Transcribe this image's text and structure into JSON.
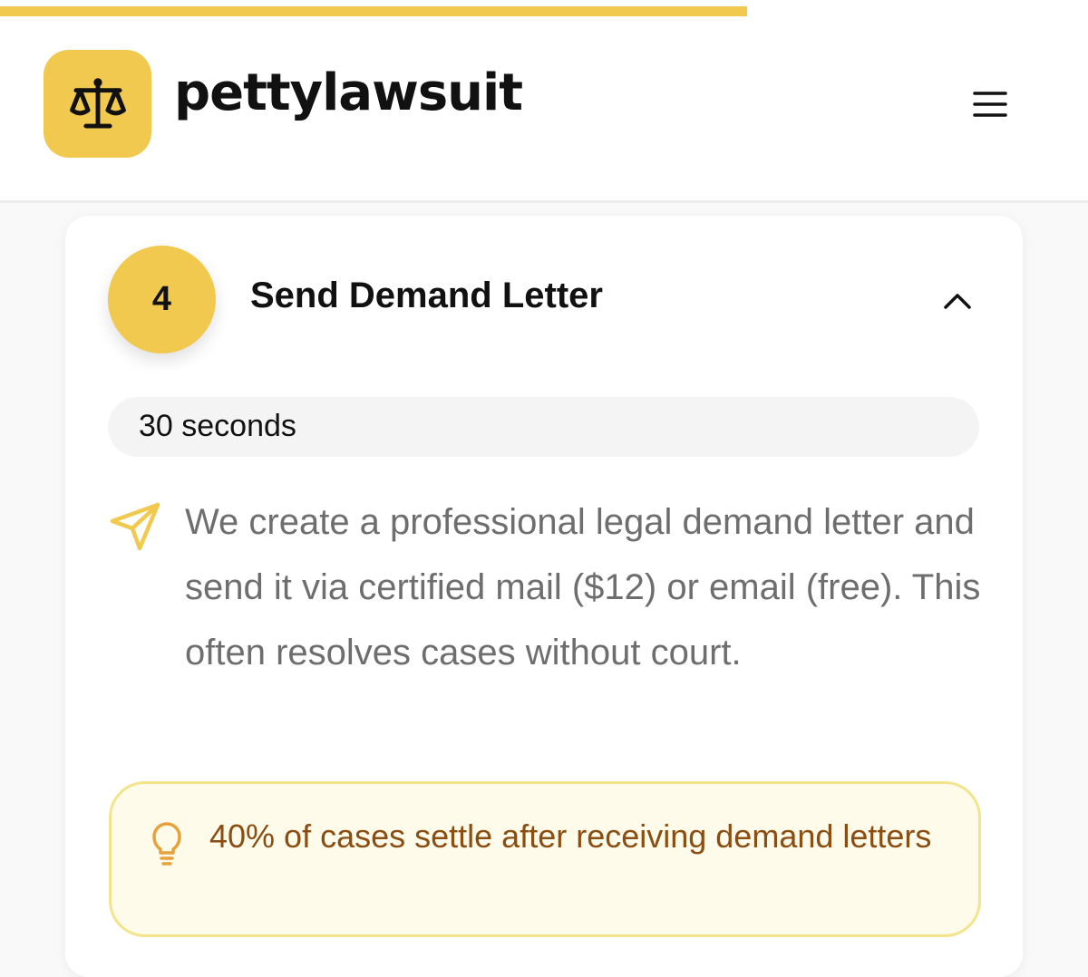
{
  "progress": {
    "value_fraction": 0.687,
    "color": "#f0c94e"
  },
  "header": {
    "logo_icon": "scales-icon",
    "brand_name": "pettylawsuit",
    "menu_icon": "hamburger-menu-icon"
  },
  "step": {
    "number": "4",
    "title": "Send Demand Letter",
    "toggle_icon": "chevron-up-icon",
    "duration": "30 seconds",
    "description_icon": "send-icon",
    "description": "We create a professional legal demand letter and send it via certified mail ($12) or email (free). This often resolves cases without court.",
    "tip": {
      "icon": "lightbulb-icon",
      "text": "40% of cases settle after receiving demand letters"
    }
  },
  "colors": {
    "accent": "#f0c94e",
    "tip_background": "#fefbea",
    "tip_border": "#f3e38a",
    "tip_text": "#8a4d12",
    "description_text": "#6e6e6e"
  }
}
